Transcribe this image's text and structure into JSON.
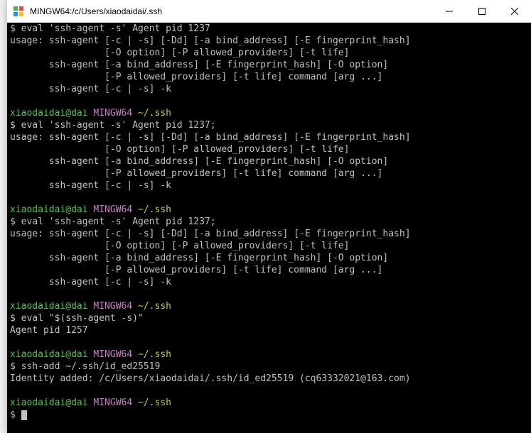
{
  "titlebar": {
    "title": "MINGW64:/c/Users/xiaodaidai/.ssh"
  },
  "prompt": {
    "user_host": "xiaodaidai@dai",
    "env": "MINGW64",
    "path": "~/.ssh",
    "symbol": "$"
  },
  "blocks": [
    {
      "prompt_before": false,
      "cmd": "eval 'ssh-agent -s' Agent pid 1237",
      "out": [
        "usage: ssh-agent [-c | -s] [-Dd] [-a bind_address] [-E fingerprint_hash]",
        "                 [-O option] [-P allowed_providers] [-t life]",
        "       ssh-agent [-a bind_address] [-E fingerprint_hash] [-O option]",
        "                 [-P allowed_providers] [-t life] command [arg ...]",
        "       ssh-agent [-c | -s] -k"
      ]
    },
    {
      "prompt_before": true,
      "cmd": "eval 'ssh-agent -s' Agent pid 1237;",
      "out": [
        "usage: ssh-agent [-c | -s] [-Dd] [-a bind_address] [-E fingerprint_hash]",
        "                 [-O option] [-P allowed_providers] [-t life]",
        "       ssh-agent [-a bind_address] [-E fingerprint_hash] [-O option]",
        "                 [-P allowed_providers] [-t life] command [arg ...]",
        "       ssh-agent [-c | -s] -k"
      ]
    },
    {
      "prompt_before": true,
      "cmd": "eval 'ssh-agent -s' Agent pid 1237;",
      "out": [
        "usage: ssh-agent [-c | -s] [-Dd] [-a bind_address] [-E fingerprint_hash]",
        "                 [-O option] [-P allowed_providers] [-t life]",
        "       ssh-agent [-a bind_address] [-E fingerprint_hash] [-O option]",
        "                 [-P allowed_providers] [-t life] command [arg ...]",
        "       ssh-agent [-c | -s] -k"
      ]
    },
    {
      "prompt_before": true,
      "cmd": "eval \"$(ssh-agent -s)\"",
      "out": [
        "Agent pid 1257"
      ]
    },
    {
      "prompt_before": true,
      "cmd": "ssh-add ~/.ssh/id_ed25519",
      "out": [
        "Identity added: /c/Users/xiaodaidai/.ssh/id_ed25519 (cq63332021@163.com)"
      ]
    }
  ]
}
